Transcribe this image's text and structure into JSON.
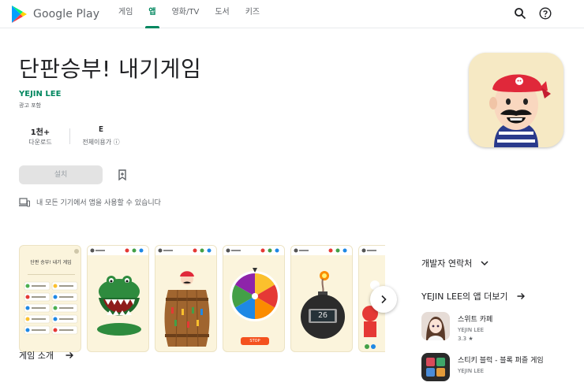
{
  "header": {
    "brand": "Google Play",
    "nav": [
      "게임",
      "앱",
      "영화/TV",
      "도서",
      "키즈"
    ],
    "active_nav": "앱",
    "icons": [
      "search-icon",
      "help-icon"
    ]
  },
  "app": {
    "title": "단판승부! 내기게임",
    "developer": "YEJIN LEE",
    "ads_notice": "광고 포함",
    "downloads_value": "1천+",
    "downloads_label": "다운로드",
    "rating_value": "E",
    "rating_label": "전체이용가 ⓘ",
    "install_label": "설치",
    "devices_text": "내 모든 기기에서 앱을 사용할 수 있습니다"
  },
  "screenshots": {
    "shot1_title": "단판 승부! 내기 게임",
    "shot_bomb_display": "26",
    "shot_stop": "STOP"
  },
  "sidebar": {
    "dev_contact": "개발자 연락처",
    "more_by": "YEJIN LEE의 앱 더보기",
    "similar": [
      {
        "name": "스위트 카페",
        "dev": "YEJIN LEE",
        "rating": "3.3 ★"
      },
      {
        "name": "스티키 블럭 - 블록 퍼즐 게임",
        "dev": "YEJIN LEE"
      }
    ]
  },
  "about": {
    "label": "게임 소개"
  },
  "colors": {
    "accent": "#01875f"
  }
}
